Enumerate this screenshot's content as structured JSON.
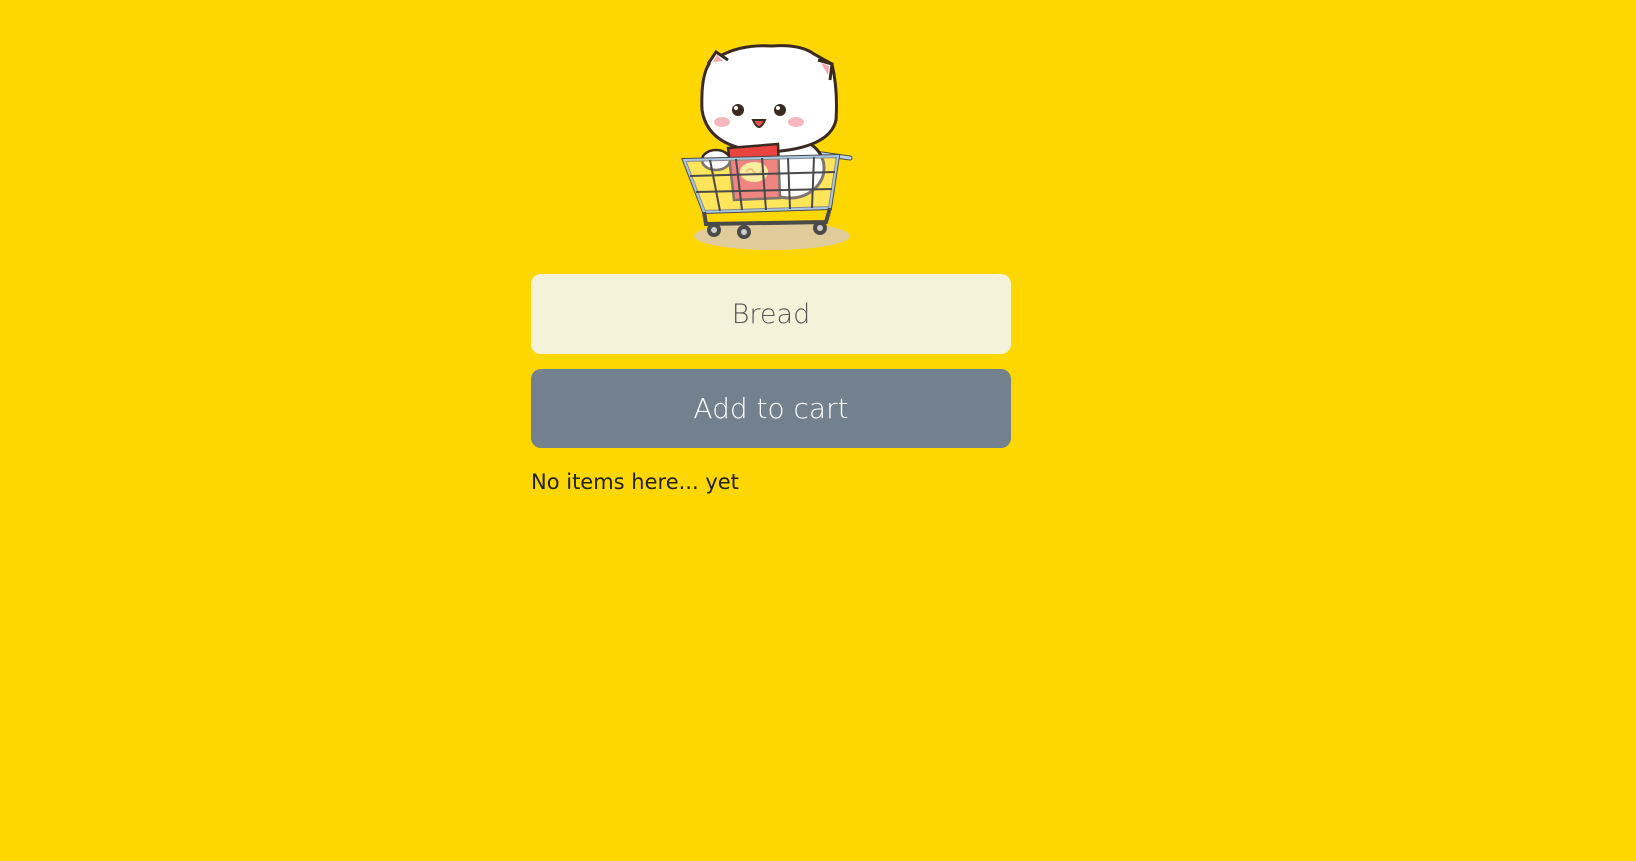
{
  "app": {
    "mascot_icon": "cat-in-shopping-cart-icon"
  },
  "form": {
    "input_value": "Bread",
    "button_label": "Add to cart"
  },
  "list": {
    "empty_message": "No items here... yet"
  },
  "colors": {
    "background": "#FFD700",
    "input_background": "#F4F3DA",
    "button_background": "#73808E",
    "button_text": "#FFFFFF"
  }
}
